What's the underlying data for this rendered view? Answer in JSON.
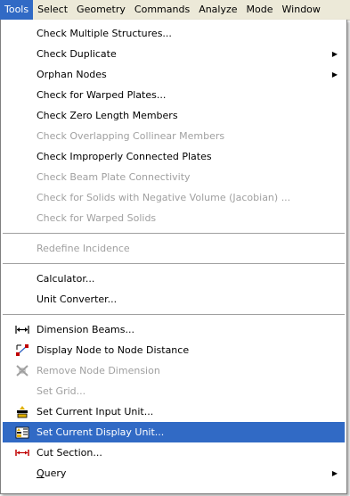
{
  "menubar": {
    "items": [
      "Tools",
      "Select",
      "Geometry",
      "Commands",
      "Analyze",
      "Mode",
      "Window"
    ]
  },
  "menu": {
    "group1": [
      {
        "label": "Check Multiple Structures...",
        "disabled": false
      },
      {
        "label": "Check Duplicate",
        "disabled": false,
        "submenu": true
      },
      {
        "label": "Orphan Nodes",
        "disabled": false,
        "submenu": true
      },
      {
        "label": "Check for Warped Plates...",
        "disabled": false
      },
      {
        "label": "Check Zero Length Members",
        "disabled": false
      },
      {
        "label": "Check Overlapping Collinear Members",
        "disabled": true
      },
      {
        "label": "Check Improperly Connected Plates",
        "disabled": false
      },
      {
        "label": "Check Beam Plate Connectivity",
        "disabled": true
      },
      {
        "label": "Check for Solids with Negative Volume (Jacobian) ...",
        "disabled": true
      },
      {
        "label": "Check for Warped Solids",
        "disabled": true
      }
    ],
    "group2": [
      {
        "label": "Redefine Incidence",
        "disabled": true
      }
    ],
    "group3": [
      {
        "label": "Calculator...",
        "disabled": false
      },
      {
        "label": "Unit Converter...",
        "disabled": false
      }
    ],
    "group4": [
      {
        "label": "Dimension Beams...",
        "icon": "dimension-beams-icon",
        "disabled": false
      },
      {
        "label": "Display Node to Node Distance",
        "icon": "node-distance-icon",
        "disabled": false
      },
      {
        "label": "Remove Node Dimension",
        "icon": "remove-dimension-icon",
        "disabled": true
      },
      {
        "label": "Set Grid...",
        "disabled": true
      },
      {
        "label": "Set Current Input Unit...",
        "icon": "input-unit-icon",
        "disabled": false
      },
      {
        "label": "Set Current Display Unit...",
        "icon": "display-unit-icon",
        "disabled": false,
        "selected": true
      },
      {
        "label": "Cut Section...",
        "icon": "cut-section-icon",
        "disabled": false
      },
      {
        "label": "Query",
        "disabled": false,
        "submenu": true,
        "underline_index": 0
      }
    ]
  },
  "colors": {
    "highlight": "#316ac5",
    "menubar_bg": "#ece9d8",
    "disabled_text": "#a0a0a0"
  }
}
